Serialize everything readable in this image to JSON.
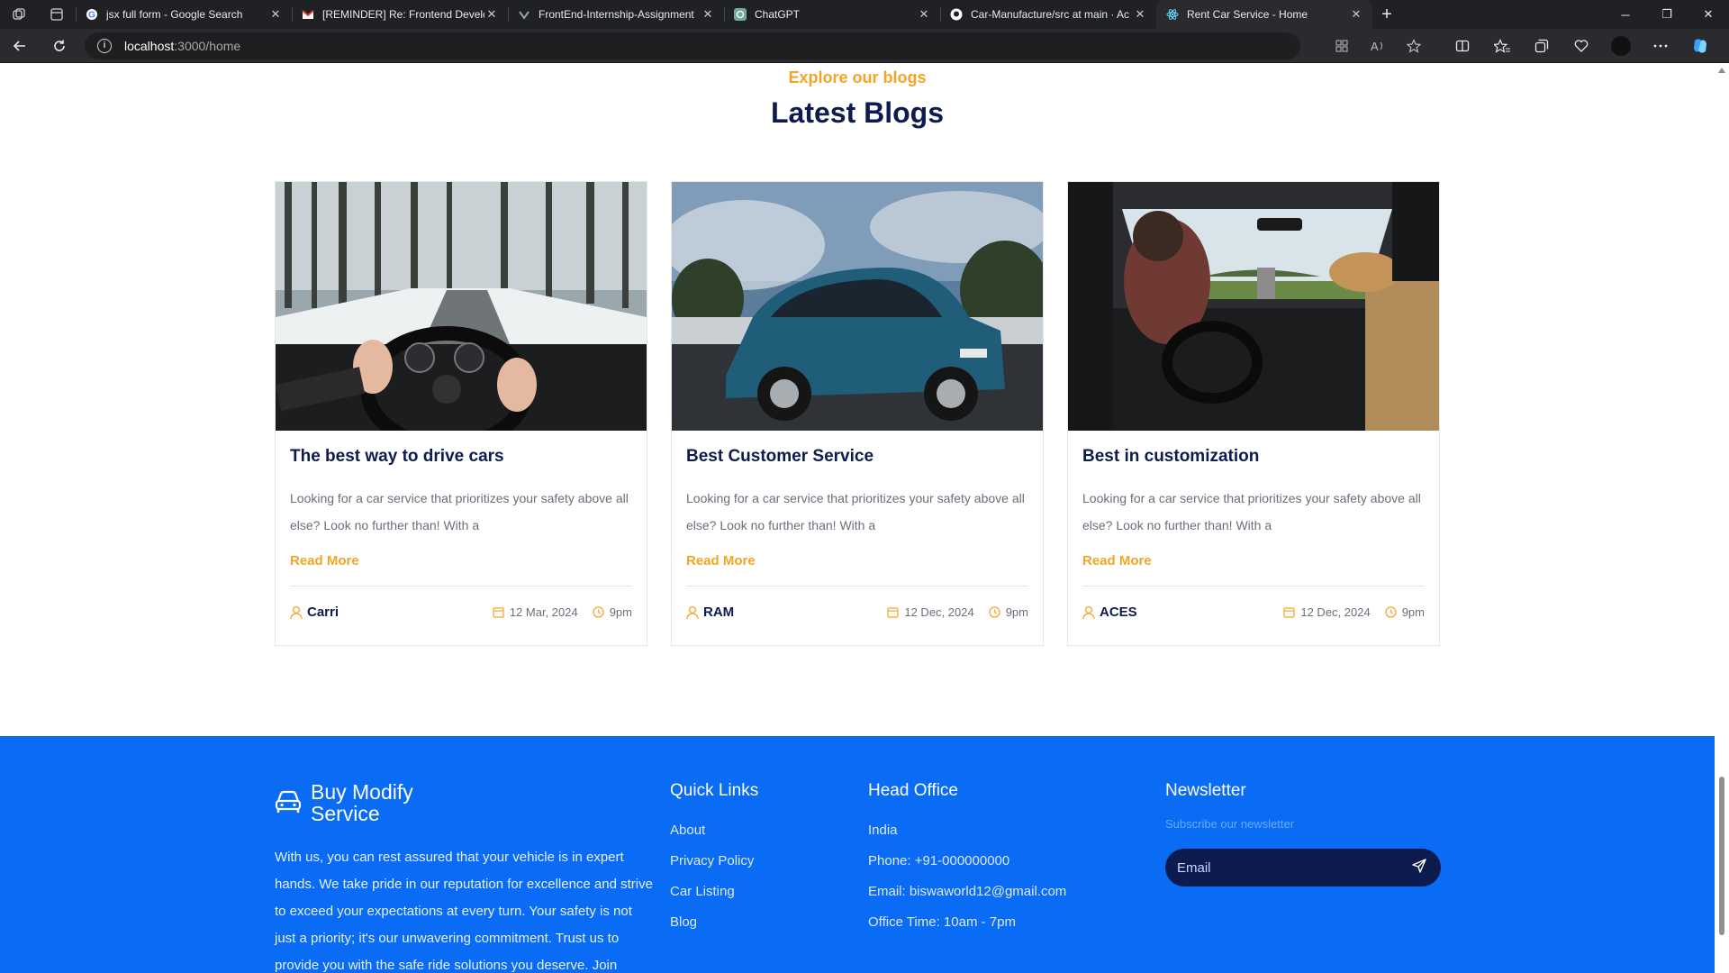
{
  "browser": {
    "tabs": [
      {
        "title": "jsx full form - Google Search",
        "favicon": "google-icon",
        "active": false
      },
      {
        "title": "[REMINDER] Re: Frontend Develo",
        "favicon": "gmail-icon",
        "active": false
      },
      {
        "title": "FrontEnd-Internship-Assignment",
        "favicon": "task-icon",
        "active": false
      },
      {
        "title": "ChatGPT",
        "favicon": "chatgpt-icon",
        "active": false
      },
      {
        "title": "Car-Manufacture/src at main · Ac",
        "favicon": "github-icon",
        "active": false
      },
      {
        "title": "Rent Car Service - Home",
        "favicon": "react-icon",
        "active": true
      }
    ],
    "url_host": "localhost",
    "url_path": ":3000/home"
  },
  "blogs": {
    "eyebrow": "Explore our blogs",
    "title": "Latest Blogs",
    "read_more": "Read More",
    "cards": [
      {
        "title": "The best way to drive cars",
        "excerpt": "Looking for a car service that prioritizes your safety above all else? Look no further than! With a",
        "author": "Carri",
        "date": "12 Mar, 2024",
        "time": "9pm"
      },
      {
        "title": "Best Customer Service",
        "excerpt": "Looking for a car service that prioritizes your safety above all else? Look no further than! With a",
        "author": "RAM",
        "date": "12 Dec, 2024",
        "time": "9pm"
      },
      {
        "title": "Best in customization",
        "excerpt": "Looking for a car service that prioritizes your safety above all else? Look no further than! With a",
        "author": "ACES",
        "date": "12 Dec, 2024",
        "time": "9pm"
      }
    ]
  },
  "footer": {
    "brand": "Buy Modify Service",
    "about": "With us, you can rest assured that your vehicle is in expert hands. We take pride in our reputation for excellence and strive to exceed your expectations at every turn. Your safety is not just a priority; it's our unwavering commitment. Trust us to provide you with the safe ride solutions you deserve. Join",
    "quick_links": {
      "title": "Quick Links",
      "items": [
        "About",
        "Privacy Policy",
        "Car Listing",
        "Blog"
      ]
    },
    "head_office": {
      "title": "Head Office",
      "items": [
        "India",
        "Phone: +91-000000000",
        "Email: biswaworld12@gmail.com",
        "Office Time: 10am - 7pm"
      ]
    },
    "newsletter": {
      "title": "Newsletter",
      "subtitle": "Subscribe our newsletter",
      "placeholder": "Email"
    }
  },
  "colors": {
    "accent": "#f5a524",
    "navy": "#0d1b4f",
    "footer_bg": "#0a6cf5"
  }
}
